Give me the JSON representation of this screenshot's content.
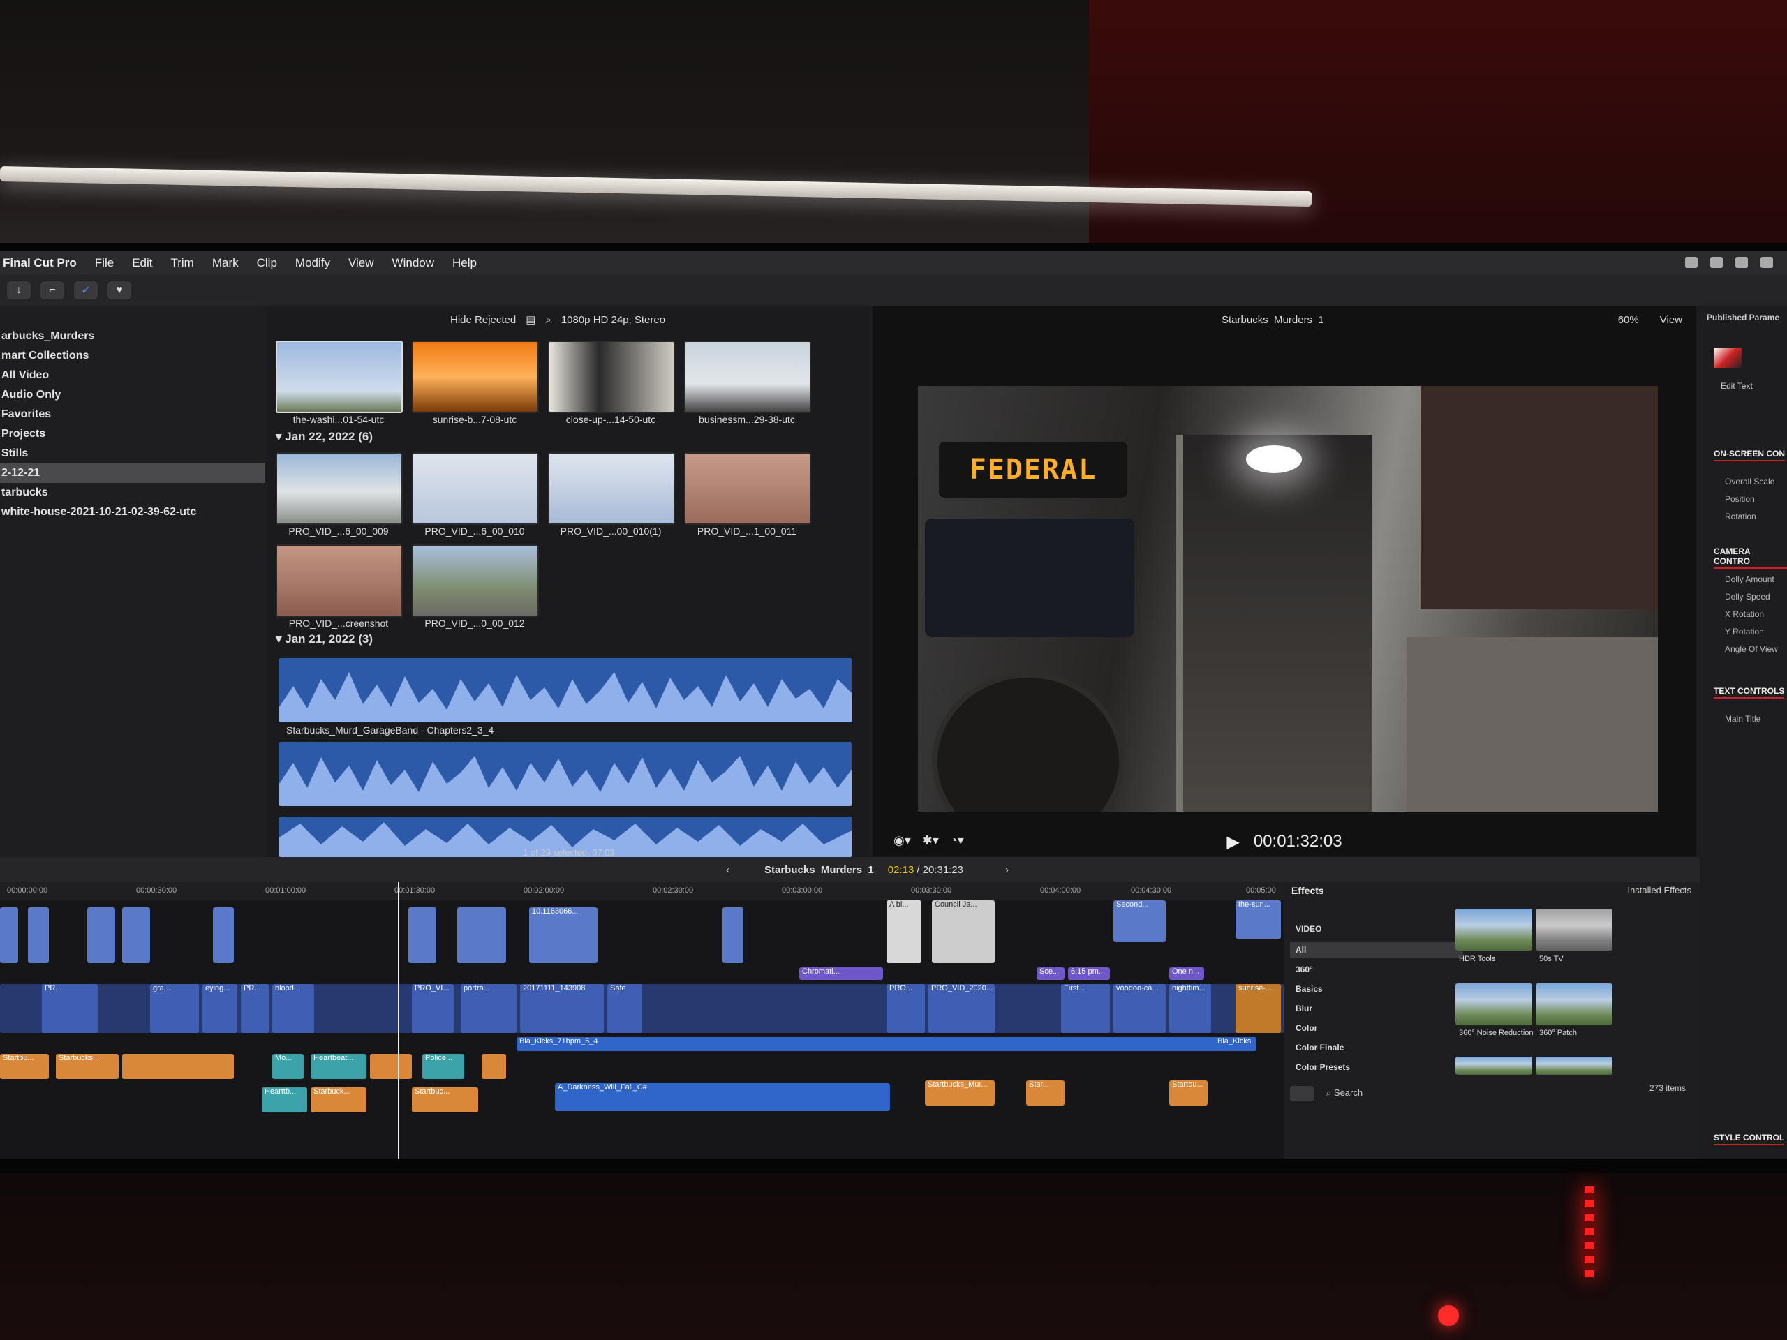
{
  "menu": {
    "app": "Final Cut Pro",
    "items": [
      "File",
      "Edit",
      "Trim",
      "Mark",
      "Clip",
      "Modify",
      "View",
      "Window",
      "Help"
    ]
  },
  "sidebar": {
    "items": [
      {
        "label": "arbucks_Murders",
        "selected": false
      },
      {
        "label": "mart Collections",
        "selected": false
      },
      {
        "label": "All Video",
        "selected": false
      },
      {
        "label": "Audio Only",
        "selected": false
      },
      {
        "label": "Favorites",
        "selected": false
      },
      {
        "label": "Projects",
        "selected": false
      },
      {
        "label": "Stills",
        "selected": false
      },
      {
        "label": "2-12-21",
        "selected": true
      },
      {
        "label": "tarbucks",
        "selected": false
      },
      {
        "label": "white-house-2021-10-21-02-39-62-utc",
        "selected": false
      }
    ]
  },
  "browser": {
    "filter": "Hide Rejected",
    "format": "1080p HD 24p, Stereo",
    "groups": [
      {
        "date": "Jan 22, 2022",
        "count": "(6)"
      },
      {
        "date": "Jan 21, 2022",
        "count": "(3)"
      }
    ],
    "thumbs_row1": [
      "the-washi...01-54-utc",
      "sunrise-b...7-08-utc",
      "close-up-...14-50-utc",
      "businessm...29-38-utc"
    ],
    "thumbs_row2": [
      "PRO_VID_...6_00_009",
      "PRO_VID_...6_00_010",
      "PRO_VID_...00_010(1)",
      "PRO_VID_...1_00_011"
    ],
    "thumbs_row3": [
      "PRO_VID_...creenshot",
      "PRO_VID_...0_00_012"
    ],
    "audio_clip": "Starbucks_Murd_GarageBand - Chapters2_3_4",
    "selection_status": "1 of 29 selected, 07:03"
  },
  "viewer": {
    "project": "Starbucks_Murders_1",
    "zoom": "60%",
    "view_menu": "View",
    "sign_text": "FEDERAL",
    "timecode": "00:01:32:03"
  },
  "timeline": {
    "project": "Starbucks_Murders_1",
    "position": "02:13",
    "duration": "/ 20:31:23",
    "ruler": [
      "00:00:00:00",
      "00:00:30:00",
      "00:01:00:00",
      "00:01:30:00",
      "00:02:00:00",
      "00:02:30:00",
      "00:03:00:00",
      "00:03:30:00",
      "00:04:00:00",
      "00:04:30:00",
      "00:05:00"
    ],
    "connected_titles": [
      "10.1163066...",
      "A bl...",
      "Council Ja...",
      "Second...",
      "the-sun..."
    ],
    "storyline_labels": [
      "PR...",
      "gra...",
      "eying...",
      "PR...",
      "blood...",
      "PRO_VI...",
      "portra...",
      "20171111_143908",
      "Safe",
      "PRO...",
      "PRO_VID_2020...",
      "First...",
      "voodoo-ca...",
      "nighttim...",
      "sunrise-..."
    ],
    "music_label": "Bla_Kicks_71bpm_5_4",
    "audio_labels": [
      "Startbu...",
      "Starbucks...",
      "Mo...",
      "Heartbeat...",
      "Police...",
      "Startbucks_Mur...",
      "Star...",
      "Startbu...",
      "Hearttb...",
      "Starbuck...",
      "Startbuc...",
      "A_Darkness_Will_Fall_C#",
      "Bla_Kicks..."
    ],
    "purple_titles": [
      "Chromati...",
      "Sce...",
      "6:15 pm...",
      "One n..."
    ]
  },
  "effects": {
    "title": "Effects",
    "installed": "Installed Effects",
    "categories": [
      "VIDEO",
      "All",
      "360°",
      "Basics",
      "Blur",
      "Color",
      "Color Finale",
      "Color Presets"
    ],
    "thumbs": [
      "HDR Tools",
      "50s TV",
      "360° Noise Reduction",
      "360° Patch"
    ],
    "search_placeholder": "Search",
    "count": "273 items"
  },
  "inspector": {
    "published": "Published Parame",
    "edit_text": "Edit Text",
    "sections": [
      "ON-SCREEN CON",
      "CAMERA CONTRO",
      "TEXT CONTROLS",
      "STYLE CONTROL"
    ],
    "rows_onscreen": [
      "Overall Scale",
      "Position",
      "Rotation"
    ],
    "rows_camera": [
      "Dolly Amount",
      "Dolly Speed",
      "X Rotation",
      "Y Rotation",
      "Angle Of View"
    ],
    "rows_text": [
      "Main Title"
    ]
  },
  "colors": {
    "accent": "#4a8cff",
    "video_clip": "#3f5fb4",
    "audio_clip": "#d9883a",
    "waveform": "#2d5aa8"
  }
}
